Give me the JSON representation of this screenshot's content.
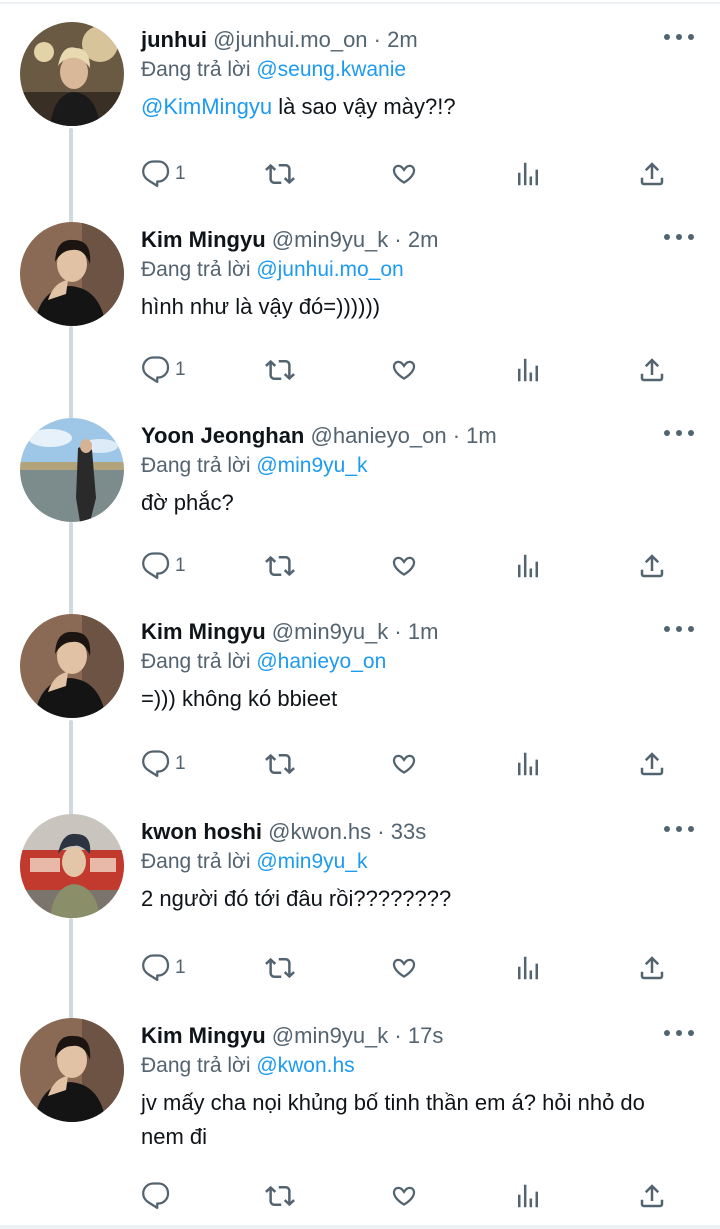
{
  "tweets": [
    {
      "name": "junhui",
      "handle": "@junhui.mo_on",
      "time": "· 2m",
      "reply_prefix": "Đang trả lời",
      "reply_to": "@seung.kwanie",
      "mention": "@KimMingyu",
      "text": " là sao vậy mày?!?",
      "reply_count": "1"
    },
    {
      "name": "Kim Mingyu",
      "handle": "@min9yu_k",
      "time": "· 2m",
      "reply_prefix": "Đang trả lời",
      "reply_to": "@junhui.mo_on",
      "mention": "",
      "text": "hình như là vậy đó=))))))",
      "reply_count": "1"
    },
    {
      "name": "Yoon Jeonghan",
      "handle": "@hanieyo_on",
      "time": "· 1m",
      "reply_prefix": "Đang trả lời",
      "reply_to": "@min9yu_k",
      "mention": "",
      "text": "đờ phắc?",
      "reply_count": "1"
    },
    {
      "name": "Kim Mingyu",
      "handle": "@min9yu_k",
      "time": "· 1m",
      "reply_prefix": "Đang trả lời",
      "reply_to": "@hanieyo_on",
      "mention": "",
      "text": "=))) không kó bbieet",
      "reply_count": "1"
    },
    {
      "name": "kwon hoshi",
      "handle": "@kwon.hs",
      "time": "· 33s",
      "reply_prefix": "Đang trả lời",
      "reply_to": "@min9yu_k",
      "mention": "",
      "text": "2 người đó tới đâu rồi????????",
      "reply_count": "1"
    },
    {
      "name": "Kim Mingyu",
      "handle": "@min9yu_k",
      "time": "· 17s",
      "reply_prefix": "Đang trả lời",
      "reply_to": "@kwon.hs",
      "mention": "",
      "text": "jv mấy cha nọi khủng bố tinh thần em á? hỏi nhỏ do nem đi",
      "reply_count": ""
    }
  ],
  "icons": {
    "reply": "reply-icon",
    "retweet": "retweet-icon",
    "like": "heart-icon",
    "views": "analytics-icon",
    "share": "share-icon",
    "more": "more-icon"
  },
  "colors": {
    "accent": "#1d9bf0",
    "secondary_text": "#536471",
    "thread_line": "#cfd9de"
  }
}
